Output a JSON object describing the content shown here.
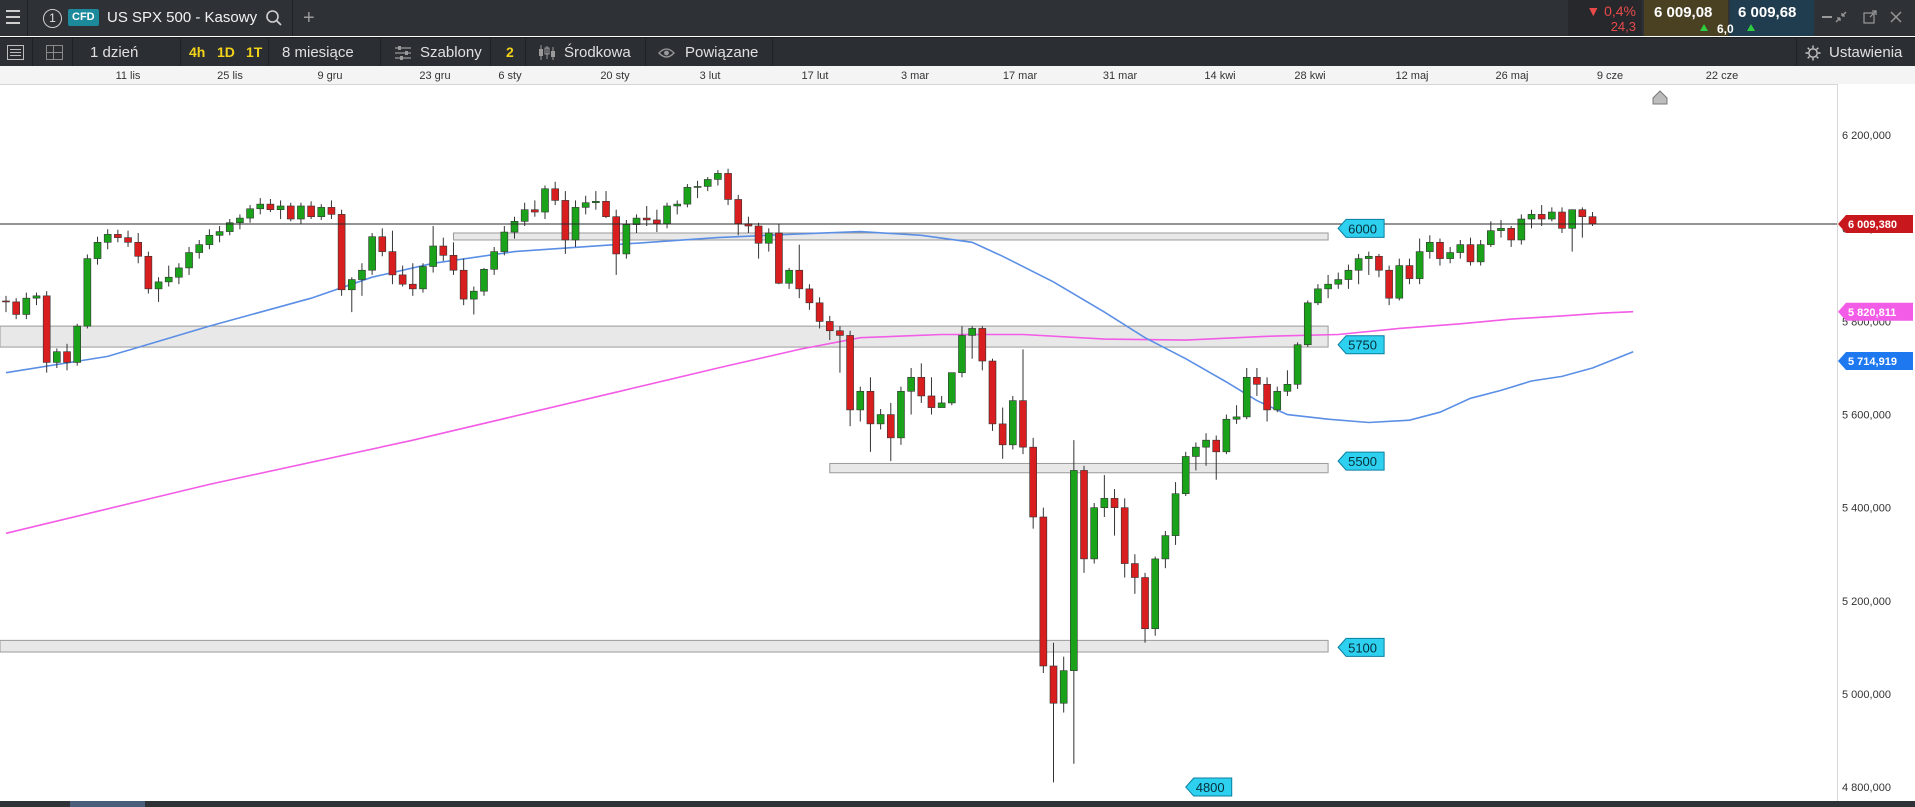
{
  "topbar": {
    "tab_number": "1",
    "cfd_badge": "CFD",
    "instrument": "US SPX 500 - Kasowy",
    "add_tab": "+",
    "change_pct": "▼ 0,4%",
    "change_abs": "24,3",
    "sell_price": "6 009,08",
    "buy_price": "6 009,68",
    "spread": "6,0"
  },
  "toolbar": {
    "interval": "1 dzień",
    "quick_4h": "4h",
    "quick_1d": "1D",
    "quick_1t": "1T",
    "range": "8 miesiące",
    "templates": "Szablony",
    "indicator_count": "2",
    "center": "Środkowa",
    "related": "Powiązane",
    "settings": "Ustawienia"
  },
  "colors": {
    "up": "#1aa31a",
    "down": "#d81e1e",
    "ma_fast": "#5b8fe6",
    "ma_slow": "#f25ce6",
    "level_label": "#2ed0f0",
    "price_label": "#c8181e"
  },
  "chart_data": {
    "type": "candlestick",
    "title": "",
    "x_axis_labels": [
      "11 lis",
      "25 lis",
      "9 gru",
      "23 gru",
      "6 sty",
      "20 sty",
      "3 lut",
      "17 lut",
      "3 mar",
      "17 mar",
      "31 mar",
      "14 kwi",
      "28 kwi",
      "12 maj",
      "26 maj",
      "9 cze",
      "22 cze"
    ],
    "y_axis_labels": [
      "6 200,000",
      "6 000,000",
      "5 800,000",
      "5 600,000",
      "5 400,000",
      "5 200,000",
      "5 000,000",
      "4 800,000"
    ],
    "ylim": [
      4770,
      6310
    ],
    "last_price_label": "6 009,380",
    "last_price": 6009.38,
    "ma_labels": [
      {
        "text": "5 820,811",
        "value": 5820.811,
        "color": "#f25ce6"
      },
      {
        "text": "5 714,919",
        "value": 5714.919,
        "color": "#1e78f0"
      }
    ],
    "levels": [
      {
        "label": "6000",
        "value": 6000,
        "zone": [
          5975,
          5990
        ],
        "from_day": 44
      },
      {
        "label": "5750",
        "value": 5750,
        "zone": [
          5745,
          5790
        ],
        "from_day": 0
      },
      {
        "label": "5500",
        "value": 5500,
        "zone": [
          5475,
          5495
        ],
        "from_day": 81
      },
      {
        "label": "5100",
        "value": 5100,
        "zone": [
          5090,
          5115
        ],
        "from_day": 0
      },
      {
        "label": "4800",
        "value": 4800
      }
    ],
    "candles": [
      [
        5844,
        5855,
        5820,
        5842
      ],
      [
        5842,
        5850,
        5805,
        5815
      ],
      [
        5815,
        5862,
        5805,
        5850
      ],
      [
        5850,
        5862,
        5835,
        5855
      ],
      [
        5855,
        5865,
        5690,
        5712
      ],
      [
        5712,
        5742,
        5700,
        5735
      ],
      [
        5735,
        5752,
        5695,
        5712
      ],
      [
        5712,
        5795,
        5705,
        5790
      ],
      [
        5790,
        5944,
        5785,
        5935
      ],
      [
        5935,
        5982,
        5922,
        5970
      ],
      [
        5970,
        5998,
        5955,
        5987
      ],
      [
        5987,
        5997,
        5970,
        5980
      ],
      [
        5980,
        5995,
        5960,
        5970
      ],
      [
        5970,
        5990,
        5925,
        5940
      ],
      [
        5940,
        5950,
        5860,
        5870
      ],
      [
        5870,
        5895,
        5842,
        5885
      ],
      [
        5885,
        5920,
        5875,
        5895
      ],
      [
        5895,
        5925,
        5880,
        5915
      ],
      [
        5915,
        5960,
        5900,
        5948
      ],
      [
        5948,
        5975,
        5935,
        5965
      ],
      [
        5965,
        5998,
        5955,
        5985
      ],
      [
        5985,
        6005,
        5970,
        5993
      ],
      [
        5993,
        6020,
        5985,
        6012
      ],
      [
        6012,
        6030,
        5998,
        6022
      ],
      [
        6022,
        6050,
        6012,
        6042
      ],
      [
        6042,
        6065,
        6030,
        6052
      ],
      [
        6052,
        6063,
        6035,
        6040
      ],
      [
        6040,
        6060,
        6020,
        6048
      ],
      [
        6048,
        6055,
        6015,
        6020
      ],
      [
        6020,
        6055,
        6010,
        6048
      ],
      [
        6048,
        6058,
        6020,
        6025
      ],
      [
        6025,
        6052,
        6018,
        6045
      ],
      [
        6045,
        6060,
        6020,
        6030
      ],
      [
        6030,
        6040,
        5855,
        5868
      ],
      [
        5868,
        5895,
        5820,
        5890
      ],
      [
        5890,
        5925,
        5855,
        5910
      ],
      [
        5910,
        5990,
        5900,
        5982
      ],
      [
        5982,
        6000,
        5940,
        5950
      ],
      [
        5950,
        5995,
        5880,
        5900
      ],
      [
        5900,
        5920,
        5875,
        5880
      ],
      [
        5880,
        5925,
        5855,
        5870
      ],
      [
        5870,
        5925,
        5862,
        5918
      ],
      [
        5918,
        6005,
        5905,
        5962
      ],
      [
        5962,
        5980,
        5930,
        5942
      ],
      [
        5942,
        5970,
        5900,
        5910
      ],
      [
        5910,
        5935,
        5835,
        5848
      ],
      [
        5848,
        5875,
        5815,
        5865
      ],
      [
        5865,
        5915,
        5855,
        5912
      ],
      [
        5912,
        5960,
        5900,
        5950
      ],
      [
        5950,
        6005,
        5942,
        5992
      ],
      [
        5992,
        6025,
        5978,
        6015
      ],
      [
        6015,
        6055,
        6005,
        6040
      ],
      [
        6040,
        6060,
        6025,
        6035
      ],
      [
        6035,
        6092,
        6020,
        6085
      ],
      [
        6085,
        6100,
        6050,
        6060
      ],
      [
        6060,
        6080,
        5945,
        5975
      ],
      [
        5975,
        6060,
        5960,
        6045
      ],
      [
        6045,
        6070,
        6030,
        6055
      ],
      [
        6055,
        6080,
        6040,
        6058
      ],
      [
        6058,
        6080,
        6022,
        6025
      ],
      [
        6025,
        6040,
        5900,
        5945
      ],
      [
        5945,
        6018,
        5935,
        6008
      ],
      [
        6008,
        6030,
        5990,
        6022
      ],
      [
        6022,
        6048,
        6005,
        6018
      ],
      [
        6018,
        6040,
        5992,
        6010
      ],
      [
        6010,
        6055,
        6000,
        6048
      ],
      [
        6048,
        6060,
        6030,
        6052
      ],
      [
        6052,
        6095,
        6045,
        6088
      ],
      [
        6088,
        6102,
        6065,
        6090
      ],
      [
        6090,
        6110,
        6080,
        6105
      ],
      [
        6105,
        6125,
        6092,
        6118
      ],
      [
        6118,
        6128,
        6050,
        6062
      ],
      [
        6062,
        6072,
        5985,
        6010
      ],
      [
        6010,
        6025,
        5990,
        6005
      ],
      [
        6005,
        6012,
        5935,
        5968
      ],
      [
        5968,
        6000,
        5950,
        5990
      ],
      [
        5990,
        6010,
        5880,
        5882
      ],
      [
        5882,
        5915,
        5870,
        5910
      ],
      [
        5910,
        5965,
        5850,
        5870
      ],
      [
        5870,
        5880,
        5825,
        5840
      ],
      [
        5840,
        5852,
        5785,
        5800
      ],
      [
        5800,
        5812,
        5760,
        5780
      ],
      [
        5780,
        5790,
        5690,
        5770
      ],
      [
        5770,
        5780,
        5575,
        5610
      ],
      [
        5610,
        5660,
        5585,
        5650
      ],
      [
        5650,
        5680,
        5520,
        5580
      ],
      [
        5580,
        5612,
        5568,
        5600
      ],
      [
        5600,
        5625,
        5500,
        5550
      ],
      [
        5550,
        5660,
        5535,
        5650
      ],
      [
        5650,
        5700,
        5600,
        5680
      ],
      [
        5680,
        5710,
        5625,
        5640
      ],
      [
        5640,
        5680,
        5600,
        5615
      ],
      [
        5615,
        5640,
        5615,
        5625
      ],
      [
        5625,
        5690,
        5620,
        5690
      ],
      [
        5690,
        5790,
        5680,
        5770
      ],
      [
        5770,
        5790,
        5720,
        5785
      ],
      [
        5785,
        5790,
        5695,
        5715
      ],
      [
        5715,
        5720,
        5565,
        5580
      ],
      [
        5580,
        5615,
        5505,
        5535
      ],
      [
        5535,
        5640,
        5525,
        5630
      ],
      [
        5630,
        5740,
        5515,
        5530
      ],
      [
        5530,
        5550,
        5355,
        5380
      ],
      [
        5380,
        5400,
        5045,
        5060
      ],
      [
        5060,
        5110,
        4810,
        4980
      ],
      [
        4980,
        5080,
        4960,
        5050
      ],
      [
        5050,
        5545,
        4850,
        5480
      ],
      [
        5480,
        5490,
        5260,
        5290
      ],
      [
        5290,
        5410,
        5280,
        5400
      ],
      [
        5400,
        5470,
        5380,
        5420
      ],
      [
        5420,
        5440,
        5340,
        5400
      ],
      [
        5400,
        5420,
        5250,
        5280
      ],
      [
        5280,
        5300,
        5215,
        5250
      ],
      [
        5250,
        5260,
        5110,
        5140
      ],
      [
        5140,
        5295,
        5125,
        5290
      ],
      [
        5290,
        5350,
        5270,
        5340
      ],
      [
        5340,
        5455,
        5320,
        5430
      ],
      [
        5430,
        5520,
        5425,
        5510
      ],
      [
        5510,
        5540,
        5480,
        5530
      ],
      [
        5530,
        5560,
        5490,
        5545
      ],
      [
        5545,
        5555,
        5460,
        5520
      ],
      [
        5520,
        5600,
        5515,
        5590
      ],
      [
        5590,
        5620,
        5580,
        5595
      ],
      [
        5595,
        5700,
        5590,
        5680
      ],
      [
        5680,
        5700,
        5640,
        5665
      ],
      [
        5665,
        5680,
        5585,
        5610
      ],
      [
        5610,
        5660,
        5605,
        5650
      ],
      [
        5650,
        5695,
        5640,
        5665
      ],
      [
        5665,
        5755,
        5655,
        5750
      ],
      [
        5750,
        5845,
        5745,
        5840
      ],
      [
        5840,
        5880,
        5835,
        5870
      ],
      [
        5870,
        5900,
        5850,
        5880
      ],
      [
        5880,
        5905,
        5870,
        5890
      ],
      [
        5890,
        5922,
        5870,
        5910
      ],
      [
        5910,
        5945,
        5880,
        5935
      ],
      [
        5935,
        5950,
        5900,
        5940
      ],
      [
        5940,
        5945,
        5895,
        5910
      ],
      [
        5910,
        5920,
        5835,
        5850
      ],
      [
        5850,
        5935,
        5845,
        5920
      ],
      [
        5920,
        5935,
        5880,
        5892
      ],
      [
        5892,
        5978,
        5880,
        5950
      ],
      [
        5950,
        5985,
        5935,
        5970
      ],
      [
        5970,
        5978,
        5920,
        5935
      ],
      [
        5935,
        5960,
        5925,
        5948
      ],
      [
        5948,
        5975,
        5935,
        5965
      ],
      [
        5965,
        5980,
        5920,
        5928
      ],
      [
        5928,
        5975,
        5920,
        5965
      ],
      [
        5965,
        6015,
        5960,
        5995
      ],
      [
        5995,
        6018,
        5980,
        6000
      ],
      [
        6000,
        6005,
        5960,
        5975
      ],
      [
        5975,
        6030,
        5965,
        6020
      ],
      [
        6020,
        6040,
        6000,
        6030
      ],
      [
        6030,
        6050,
        6005,
        6020
      ],
      [
        6020,
        6045,
        6015,
        6035
      ],
      [
        6035,
        6045,
        5990,
        6000
      ],
      [
        6000,
        6040,
        5950,
        6040
      ],
      [
        6040,
        6045,
        5980,
        6025
      ],
      [
        6025,
        6035,
        6005,
        6009
      ]
    ],
    "ma_fast": [
      [
        0,
        5690
      ],
      [
        10,
        5725
      ],
      [
        20,
        5790
      ],
      [
        30,
        5850
      ],
      [
        36,
        5895
      ],
      [
        42,
        5925
      ],
      [
        50,
        5950
      ],
      [
        60,
        5965
      ],
      [
        70,
        5980
      ],
      [
        78,
        5988
      ],
      [
        84,
        5993
      ],
      [
        90,
        5985
      ],
      [
        95,
        5970
      ],
      [
        98,
        5940
      ],
      [
        103,
        5885
      ],
      [
        108,
        5820
      ],
      [
        112,
        5765
      ],
      [
        116,
        5720
      ],
      [
        120,
        5670
      ],
      [
        123,
        5630
      ],
      [
        126,
        5600
      ],
      [
        130,
        5590
      ],
      [
        134,
        5583
      ],
      [
        138,
        5588
      ],
      [
        141,
        5605
      ],
      [
        144,
        5635
      ],
      [
        147,
        5652
      ],
      [
        150,
        5672
      ],
      [
        153,
        5682
      ],
      [
        156,
        5700
      ],
      [
        160,
        5735
      ]
    ],
    "ma_slow": [
      [
        0,
        5345
      ],
      [
        20,
        5450
      ],
      [
        40,
        5545
      ],
      [
        60,
        5648
      ],
      [
        70,
        5700
      ],
      [
        78,
        5740
      ],
      [
        84,
        5765
      ],
      [
        92,
        5772
      ],
      [
        100,
        5772
      ],
      [
        108,
        5762
      ],
      [
        116,
        5760
      ],
      [
        124,
        5768
      ],
      [
        131,
        5772
      ],
      [
        137,
        5785
      ],
      [
        143,
        5795
      ],
      [
        148,
        5805
      ],
      [
        153,
        5812
      ],
      [
        157,
        5818
      ],
      [
        160,
        5821
      ]
    ]
  }
}
